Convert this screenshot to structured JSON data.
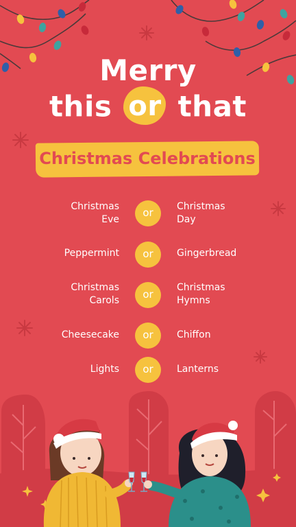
{
  "title": {
    "line1": "Merry",
    "line2_left": "this",
    "line2_or": "or",
    "line2_right": "that"
  },
  "banner": "Christmas Celebrations",
  "or_label": "or",
  "pairs": [
    {
      "left": "Christmas\nEve",
      "right": "Christmas\nDay"
    },
    {
      "left": "Peppermint",
      "right": "Gingerbread"
    },
    {
      "left": "Christmas\nCarols",
      "right": "Christmas\nHymns"
    },
    {
      "left": "Cheesecake",
      "right": "Chiffon"
    },
    {
      "left": "Lights",
      "right": "Lanterns"
    }
  ],
  "colors": {
    "background": "#e24a52",
    "accent_yellow": "#f6c23e",
    "text": "#ffffff"
  }
}
